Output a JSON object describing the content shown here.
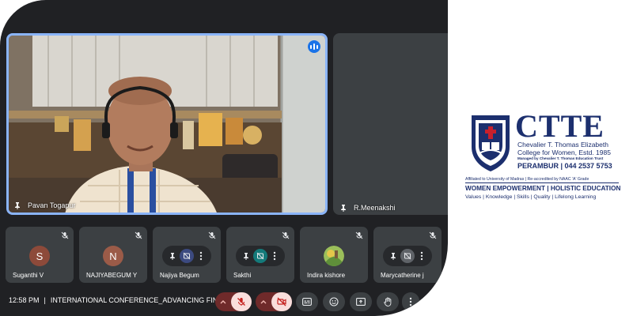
{
  "main_tile": {
    "name": "Pavan Togapur"
  },
  "side_tile": {
    "name": "R.Meenakshi"
  },
  "participants": [
    {
      "name": "Suganthi V",
      "initial": "S",
      "avatar_color": "#8d4a3a",
      "type": "avatar"
    },
    {
      "name": "NAJIYABEGUM Y",
      "initial": "N",
      "avatar_color": "#9b5b48",
      "type": "avatar"
    },
    {
      "name": "Najiya Begum",
      "type": "hover",
      "mid_color": "#3c4a80"
    },
    {
      "name": "Sakthi",
      "type": "hover",
      "mid_color": "#147a7a"
    },
    {
      "name": "Indira kishore",
      "type": "photo"
    },
    {
      "name": "Marycatherine j",
      "type": "hover",
      "mid_color": "#5f6368"
    }
  ],
  "bottom_bar": {
    "time": "12:58 PM",
    "separator": "|",
    "meeting_title": "INTERNATIONAL CONFERENCE_ADVANCING FIN..."
  },
  "logo": {
    "brand": "CTTE",
    "full_name_line1": "Chevalier T. Thomas Elizabeth",
    "full_name_line2": "College for Women, Estd. 1985",
    "managed_by": "Managed by Chevalier T. Thomas Education Trust",
    "location_phone": "PERAMBUR | 044 2537 5753",
    "affiliation": "Affiliated to University of Madras | Re-accredited by NAAC 'A' Grade",
    "tagline": "WOMEN EMPOWERMENT | HOLISTIC EDUCATION",
    "values": "Values | Knowledge | Skills | Quality | Lifelong Learning"
  },
  "colors": {
    "meet_bg": "#202124",
    "tile_bg": "#3c4043",
    "speaking_border": "#8ab4f8",
    "mute_red": "#ea4335",
    "brand_navy": "#1c2f6e"
  }
}
